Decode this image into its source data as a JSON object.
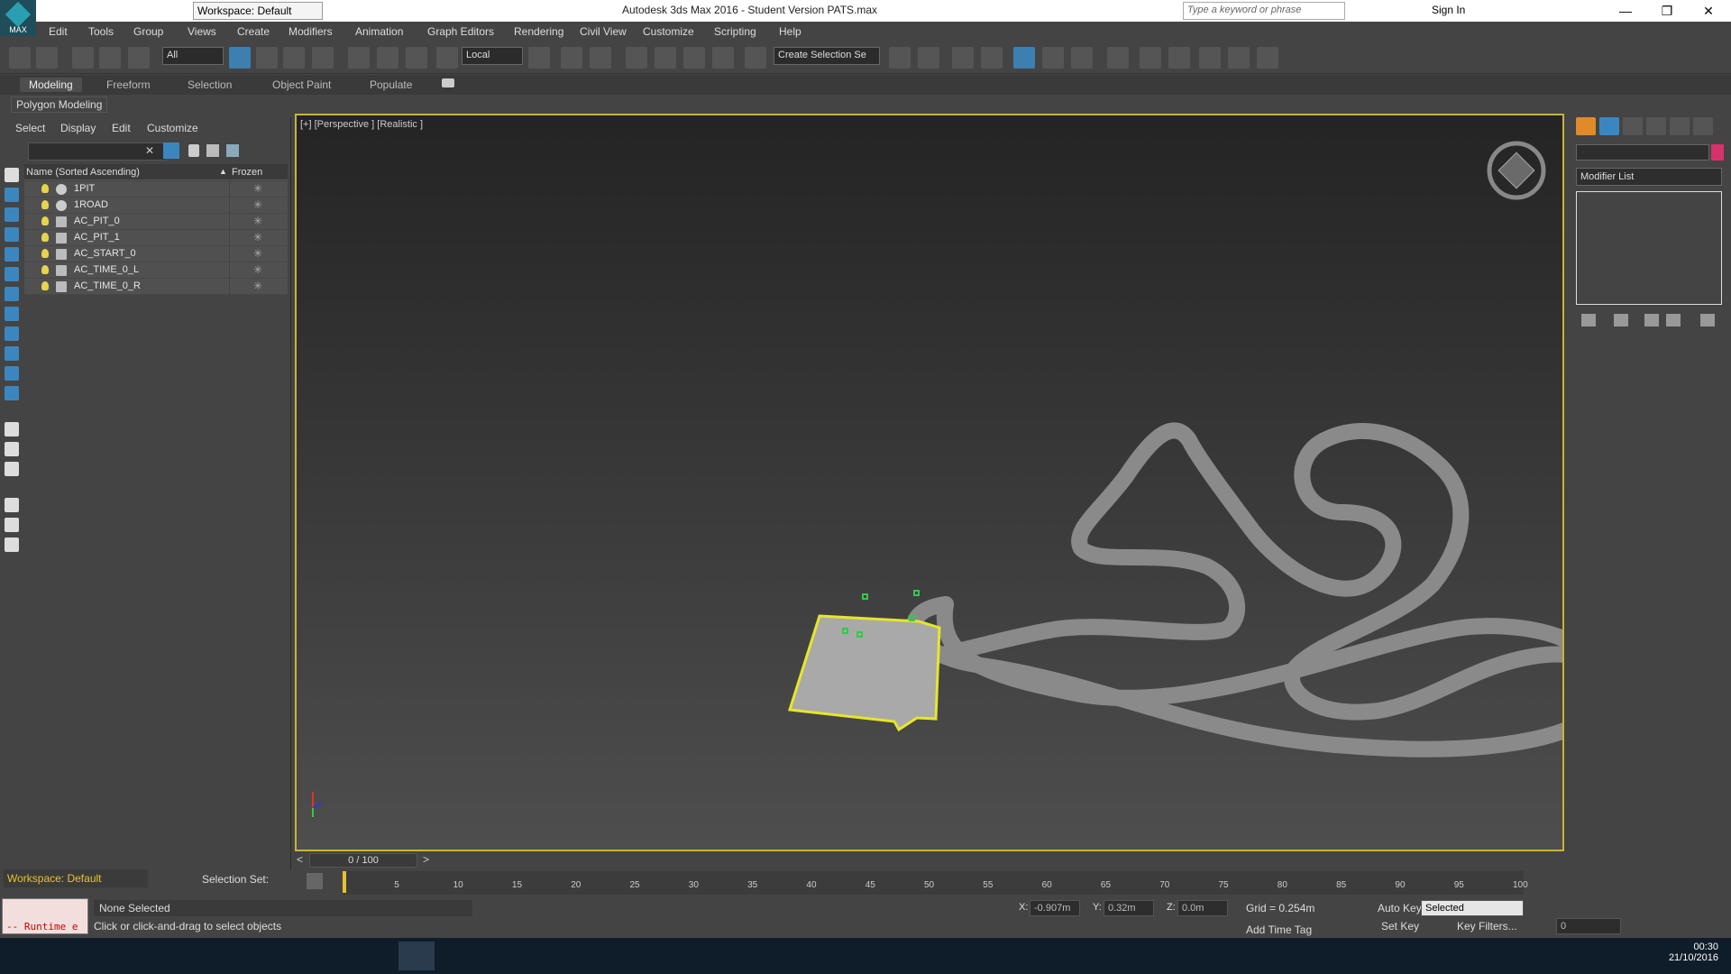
{
  "app": {
    "title": "Autodesk 3ds Max 2016 - Student Version    PATS.max",
    "logo_label": "MAX",
    "workspace": "Workspace: Default",
    "search_placeholder": "Type a keyword or phrase",
    "signin": "Sign In"
  },
  "menu": [
    "Edit",
    "Tools",
    "Group",
    "Views",
    "Create",
    "Modifiers",
    "Animation",
    "Graph Editors",
    "Rendering",
    "Civil View",
    "Customize",
    "Scripting",
    "Help"
  ],
  "toolbar": {
    "selection_filter": "All",
    "ref_coord": "Local",
    "named_selection": "Create Selection Se"
  },
  "ribbon": {
    "tabs": [
      "Modeling",
      "Freeform",
      "Selection",
      "Object Paint",
      "Populate"
    ],
    "active": "Modeling",
    "sub_label": "Polygon Modeling"
  },
  "explorer": {
    "menu": [
      "Select",
      "Display",
      "Edit",
      "Customize"
    ],
    "col_name": "Name (Sorted Ascending)",
    "col_frozen": "Frozen",
    "rows": [
      "1PIT",
      "1ROAD",
      "AC_PIT_0",
      "AC_PIT_1",
      "AC_START_0",
      "AC_TIME_0_L",
      "AC_TIME_0_R"
    ]
  },
  "viewport": {
    "label": "[+] [Perspective ] [Realistic ]"
  },
  "command_panel": {
    "modifier_list": "Modifier List"
  },
  "timeline": {
    "slider": "0 / 100",
    "ticks": [
      "5",
      "10",
      "15",
      "20",
      "25",
      "30",
      "35",
      "40",
      "45",
      "50",
      "55",
      "60",
      "65",
      "70",
      "75",
      "80",
      "85",
      "90",
      "95",
      "100"
    ]
  },
  "status": {
    "workspace": "Workspace: Default",
    "selection_set": "Selection Set:",
    "maxscript": "-- Runtime e",
    "line1": "None Selected",
    "line2": "Click or click-and-drag to select objects",
    "x_label": "X:",
    "x": "-0.907m",
    "y_label": "Y:",
    "y": "0.32m",
    "z_label": "Z:",
    "z": "0.0m",
    "grid": "Grid = 0.254m",
    "add_time_tag": "Add Time Tag",
    "auto_key": "Auto Key",
    "set_key": "Set Key",
    "key_mode": "Selected",
    "key_filters": "Key Filters...",
    "frame": "0"
  },
  "taskbar": {
    "time": "00:30",
    "date": "21/10/2016"
  }
}
